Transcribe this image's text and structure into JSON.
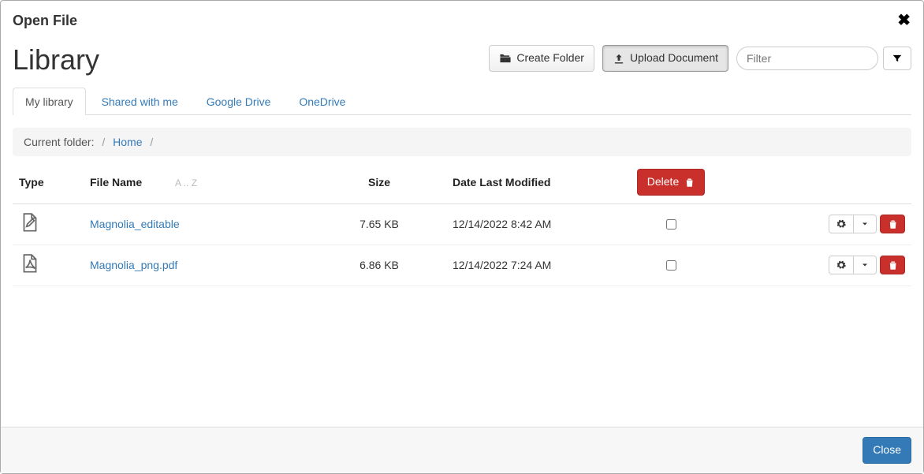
{
  "dialog": {
    "title": "Open File",
    "close_btn": "Close"
  },
  "page": {
    "title": "Library"
  },
  "toolbar": {
    "create_folder": "Create Folder",
    "upload_document": "Upload Document",
    "filter_placeholder": "Filter"
  },
  "tabs": [
    {
      "label": "My library",
      "active": true
    },
    {
      "label": "Shared with me",
      "active": false
    },
    {
      "label": "Google Drive",
      "active": false
    },
    {
      "label": "OneDrive",
      "active": false
    }
  ],
  "breadcrumb": {
    "prefix": "Current folder:",
    "home": "Home"
  },
  "columns": {
    "type": "Type",
    "filename": "File Name",
    "sort_hint": "A .. Z",
    "size": "Size",
    "modified": "Date Last Modified",
    "delete": "Delete"
  },
  "files": [
    {
      "icon": "file-edit-icon",
      "name": "Magnolia_editable",
      "size": "7.65 KB",
      "modified": "12/14/2022 8:42 AM"
    },
    {
      "icon": "file-pdf-icon",
      "name": "Magnolia_png.pdf",
      "size": "6.86 KB",
      "modified": "12/14/2022 7:24 AM"
    }
  ]
}
